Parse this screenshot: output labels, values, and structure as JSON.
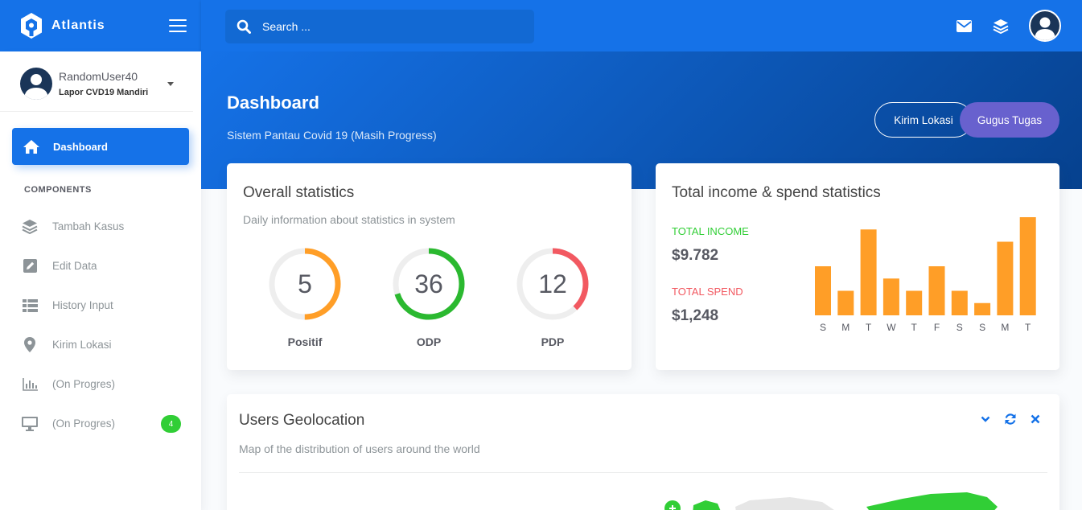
{
  "brand": {
    "name": "Atlantis"
  },
  "search": {
    "placeholder": "Search ..."
  },
  "user": {
    "name": "RandomUser40",
    "role": "Lapor CVD19 Mandiri"
  },
  "nav": {
    "active": {
      "label": "Dashboard",
      "icon": "home-icon"
    },
    "section_title": "COMPONENTS",
    "items": [
      {
        "label": "Tambah Kasus",
        "icon": "layers-icon"
      },
      {
        "label": "Edit Data",
        "icon": "pen-square-icon"
      },
      {
        "label": "History Input",
        "icon": "table-icon"
      },
      {
        "label": "Kirim Lokasi",
        "icon": "map-marker-icon"
      },
      {
        "label": "(On Progres)",
        "icon": "bar-chart-icon"
      },
      {
        "label": "(On Progres)",
        "icon": "desktop-icon",
        "badge": "4"
      }
    ]
  },
  "page": {
    "title": "Dashboard",
    "subtitle": "Sistem Pantau Covid 19 (Masih Progress)",
    "btn_location": "Kirim Lokasi",
    "btn_task": "Gugus Tugas"
  },
  "overall": {
    "title": "Overall statistics",
    "category": "Daily information about statistics in system",
    "circles": [
      {
        "value": "5",
        "label": "Positif",
        "color": "#ff9e27",
        "fraction": 0.5
      },
      {
        "value": "36",
        "label": "ODP",
        "color": "#2bb930",
        "fraction": 0.7
      },
      {
        "value": "12",
        "label": "PDP",
        "color": "#f25961",
        "fraction": 0.38
      }
    ]
  },
  "income": {
    "title": "Total income & spend statistics",
    "income_label": "TOTAL INCOME",
    "income_value": "$9.782",
    "spend_label": "TOTAL SPEND",
    "spend_value": "$1,248",
    "income_color": "#31ce36",
    "spend_color": "#f25961"
  },
  "chart_data": {
    "type": "bar",
    "categories": [
      "S",
      "M",
      "T",
      "W",
      "T",
      "F",
      "S",
      "S",
      "M",
      "T"
    ],
    "values": [
      40,
      20,
      70,
      30,
      20,
      40,
      20,
      10,
      60,
      80
    ],
    "ylim": [
      0,
      80
    ],
    "color": "#ff9e27",
    "grid": false
  },
  "geo": {
    "title": "Users Geolocation",
    "category": "Map of the distribution of users around the world"
  },
  "colors": {
    "primary": "#1572e8",
    "sidebar_text": "#8d9498"
  }
}
